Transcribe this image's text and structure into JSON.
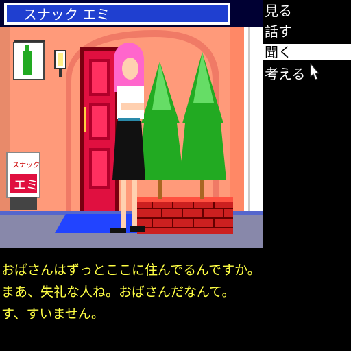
{
  "scene": {
    "shop_sign_text": "スナック エミ",
    "standing_sign_top": "スナック",
    "standing_sign_bottom": "エミ"
  },
  "menu": {
    "items": [
      {
        "label": "見る",
        "selected": false
      },
      {
        "label": "話す",
        "selected": false
      },
      {
        "label": "聞く",
        "selected": true
      },
      {
        "label": "考える",
        "selected": false
      }
    ]
  },
  "dialogue": {
    "lines": [
      "おばさんはずっとここに住んでるんですか。",
      "まあ、失礼な人ね。おばさんだなんて。",
      "す、すいません。"
    ]
  },
  "colors": {
    "wall": "#ff9a7a",
    "door": "#e01040",
    "dialogue_text": "#ffff44",
    "sky_sign": "#1f3fd0"
  }
}
